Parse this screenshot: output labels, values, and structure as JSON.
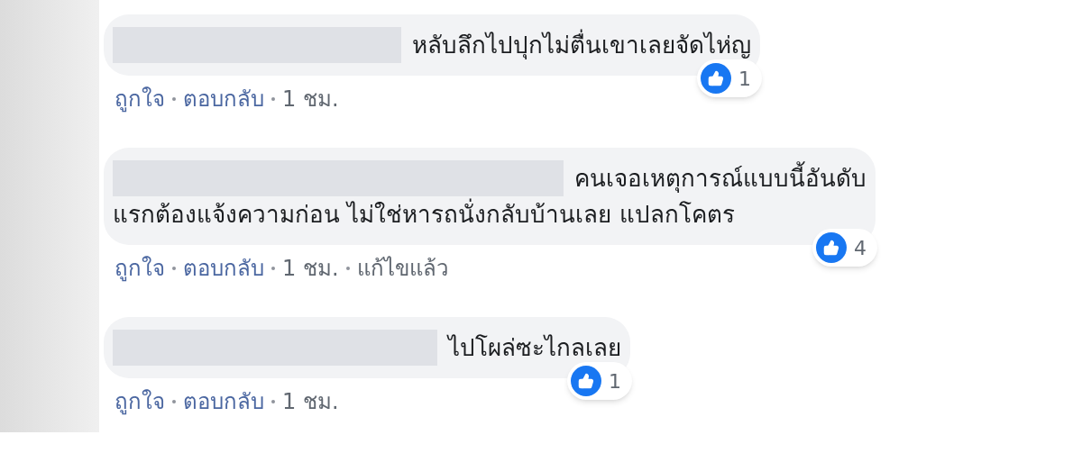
{
  "comments": [
    {
      "lines": [
        "หลับลึกไปปุกไม่ตื่นเขาเลยจัดไห่ญ"
      ],
      "reactions": "1",
      "actions": [
        {
          "kind": "link",
          "label": "ถูกใจ"
        },
        {
          "kind": "link",
          "label": "ตอบกลับ"
        },
        {
          "kind": "time",
          "label": "1 ชม."
        }
      ]
    },
    {
      "lines": [
        "คนเจอเหตุการณ์แบบนี้อันดับ",
        "แรกต้องแจ้งความก่อน ไม่ใช่หารถนั่งกลับบ้านเลย แปลกโคตร"
      ],
      "reactions": "4",
      "actions": [
        {
          "kind": "link",
          "label": "ถูกใจ"
        },
        {
          "kind": "link",
          "label": "ตอบกลับ"
        },
        {
          "kind": "time",
          "label": "1 ชม."
        },
        {
          "kind": "note",
          "label": "แก้ไขแล้ว"
        }
      ]
    },
    {
      "lines": [
        "ไปโผล่ซะไกลเลย"
      ],
      "reactions": "1",
      "actions": [
        {
          "kind": "link",
          "label": "ถูกใจ"
        },
        {
          "kind": "link",
          "label": "ตอบกลับ"
        },
        {
          "kind": "time",
          "label": "1 ชม."
        }
      ]
    }
  ]
}
